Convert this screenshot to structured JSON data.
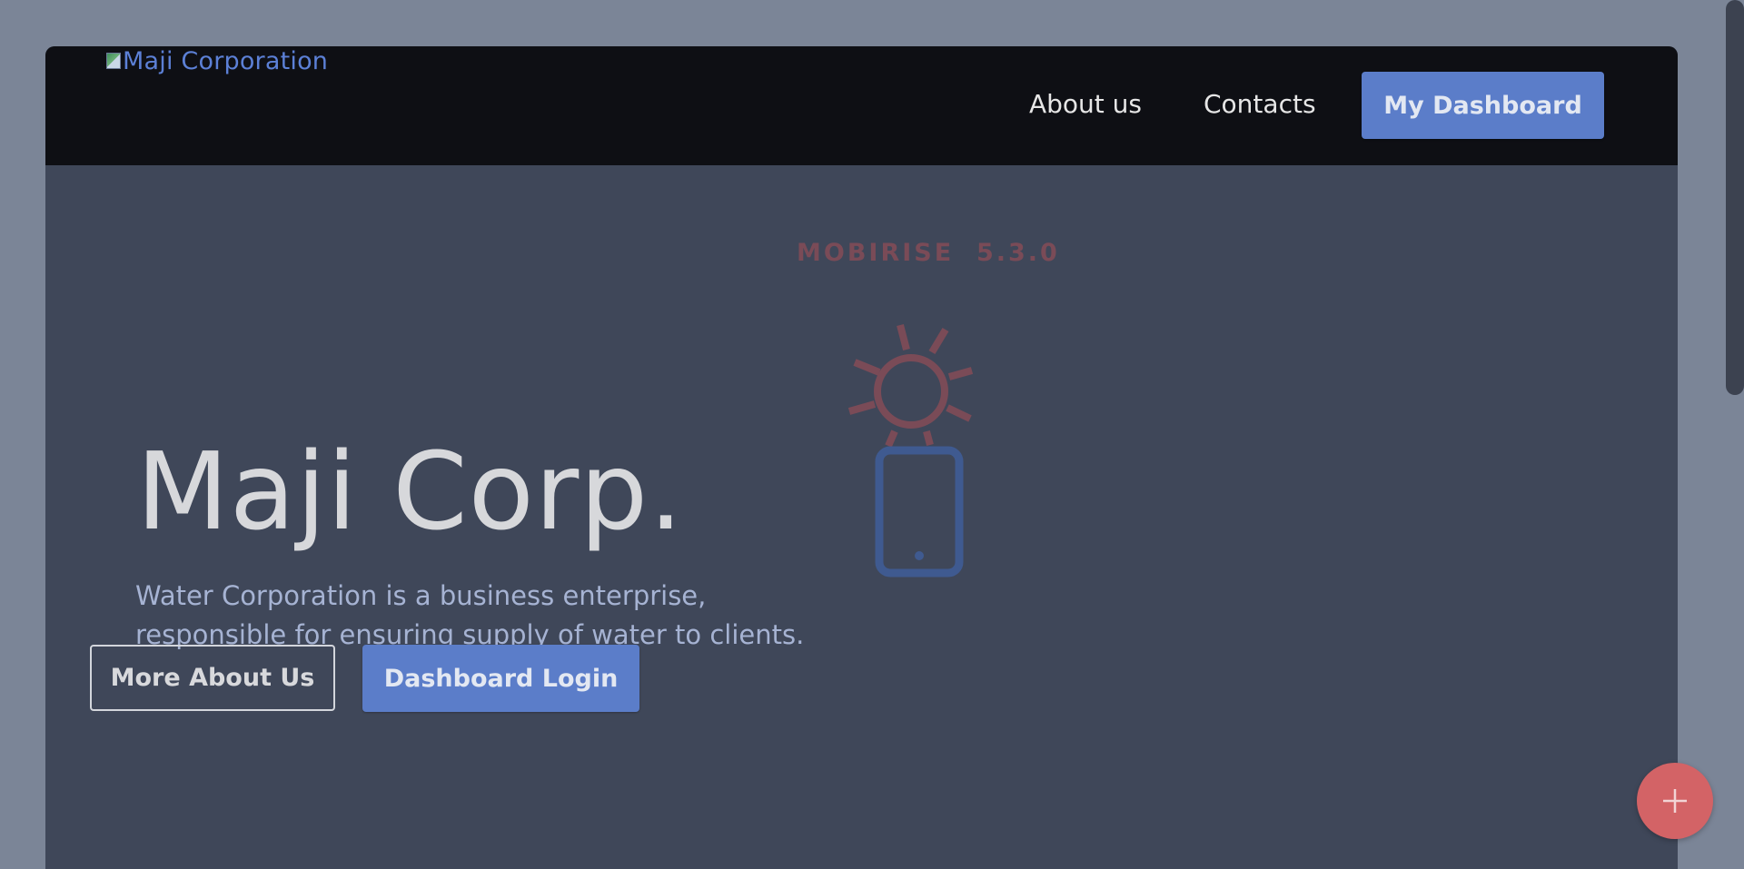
{
  "navbar": {
    "brand_alt": "Maji Corporation",
    "links": [
      {
        "label": "About us"
      },
      {
        "label": "Contacts"
      }
    ],
    "dashboard_button": "My Dashboard"
  },
  "watermark": {
    "text": "MOBIRISE  5.3.0",
    "icon": "sun-phone-icon"
  },
  "hero": {
    "title": "Maji Corp.",
    "subtitle_line1": "Water Corporation is a business enterprise,",
    "subtitle_line2": "responsible for ensuring supply of water to clients.",
    "more_button": "More About Us",
    "login_button": "Dashboard Login"
  },
  "fab": {
    "icon": "plus-icon"
  },
  "colors": {
    "page_bg": "#7b8597",
    "navbar_bg": "#0e0f14",
    "hero_bg": "#3f4759",
    "accent": "#5b7dc9",
    "fab": "#d36366",
    "watermark": "#7a4b57"
  }
}
